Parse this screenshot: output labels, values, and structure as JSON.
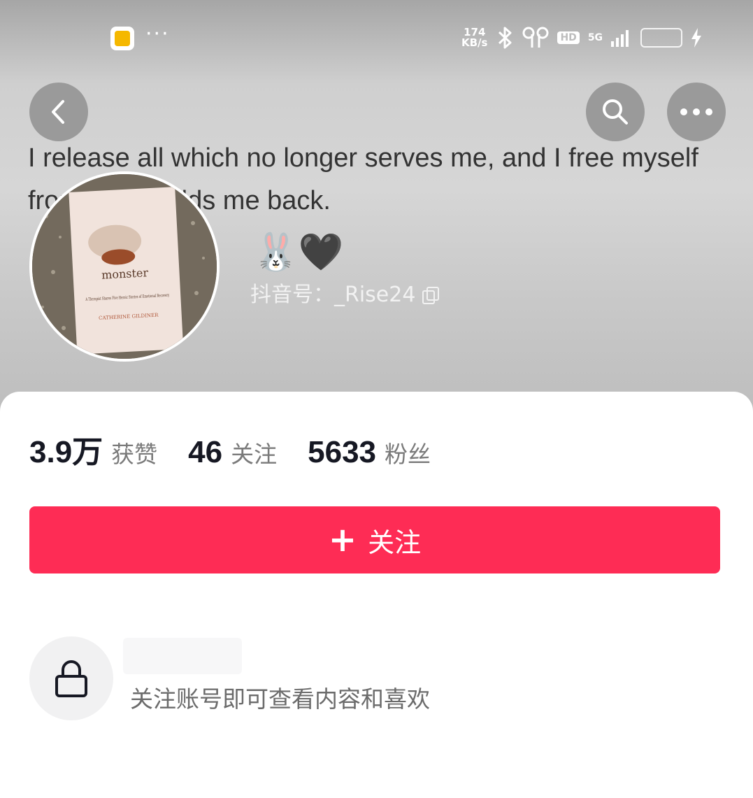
{
  "statusbar": {
    "speed_value": "174",
    "speed_unit": "KB/s",
    "hd": "HD",
    "network": "5G"
  },
  "profile": {
    "quote": "I release all which no longer serves me, and I free myself from what holds me back.",
    "name_emojis": "🐰🖤",
    "douyin_id": "抖音号：_Rise24",
    "avatar_book": {
      "title": "monster",
      "subtitle": "A Therapist Shares Five Heroic Stories of Emotional Recovery",
      "author": "CATHERINE GILDINER"
    }
  },
  "stats": [
    {
      "value": "3.9万",
      "label": "获赞"
    },
    {
      "value": "46",
      "label": "关注"
    },
    {
      "value": "5633",
      "label": "粉丝"
    }
  ],
  "follow_button": {
    "label": "关注"
  },
  "private_notice": "关注账号即可查看内容和喜欢",
  "colors": {
    "accent": "#fe2c55"
  }
}
